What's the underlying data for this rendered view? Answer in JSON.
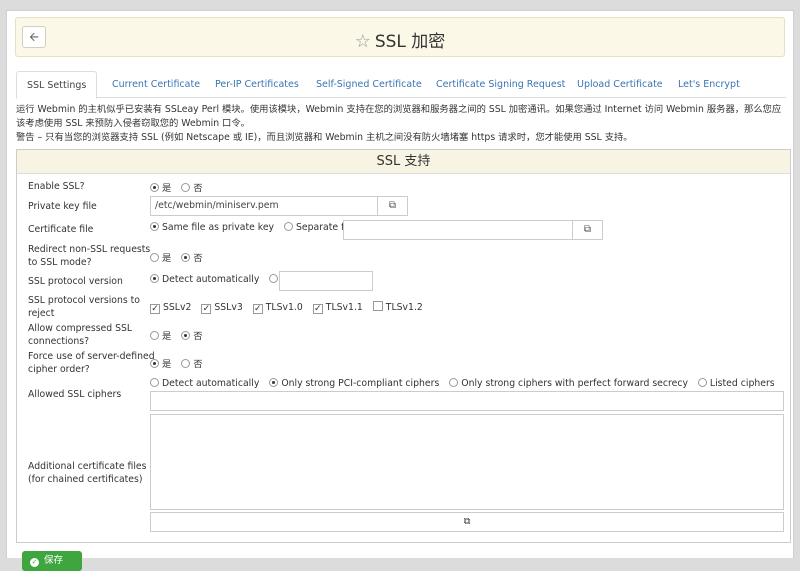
{
  "header": {
    "title": "SSL 加密",
    "back_icon": "back-arrow-icon",
    "star_icon": "star-icon"
  },
  "tabs": [
    {
      "label": "SSL Settings"
    },
    {
      "label": "Current Certificate"
    },
    {
      "label": "Per-IP Certificates"
    },
    {
      "label": "Self-Signed Certificate"
    },
    {
      "label": "Certificate Signing Request"
    },
    {
      "label": "Upload Certificate"
    },
    {
      "label": "Let's Encrypt"
    }
  ],
  "description": {
    "line1": "运行 Webmin 的主机似乎已安装有 SSLeay Perl 模块。使用该模块，Webmin 支持在您的浏览器和服务器之间的 SSL 加密通讯。如果您通过 Internet 访问 Webmin 服务器，那么您应",
    "line2": "该考虑使用 SSL 来预防入侵者窃取您的 Webmin 口令。",
    "warning": "警告 – 只有当您的浏览器支持 SSL (例如 Netscape 或 IE)，而且浏览器和 Webmin 主机之间没有防火墙堵塞 https 请求时，您才能使用 SSL 支持。"
  },
  "section": {
    "title": "SSL 支持",
    "enable_ssl": {
      "label": "Enable SSL?",
      "yes": "是",
      "no": "否"
    },
    "private_key": {
      "label": "Private key file",
      "value": "/etc/webmin/miniserv.pem"
    },
    "certificate": {
      "label": "Certificate file",
      "same": "Same file as private key",
      "separate": "Separate file"
    },
    "redirect": {
      "label": "Redirect non-SSL requests to SSL mode?",
      "yes": "是",
      "no": "否"
    },
    "protocol_version": {
      "label": "SSL protocol version",
      "auto": "Detect automatically"
    },
    "reject_versions": {
      "label": "SSL protocol versions to reject",
      "options": [
        {
          "label": "SSLv2",
          "checked": true
        },
        {
          "label": "SSLv3",
          "checked": true
        },
        {
          "label": "TLSv1.0",
          "checked": true
        },
        {
          "label": "TLSv1.1",
          "checked": true
        },
        {
          "label": "TLSv1.2",
          "checked": false
        }
      ]
    },
    "compressed": {
      "label": "Allow compressed SSL connections?",
      "yes": "是",
      "no": "否"
    },
    "force_cipher": {
      "label": "Force use of server-defined cipher order?",
      "yes": "是",
      "no": "否"
    },
    "ciphers": {
      "label": "Allowed SSL ciphers",
      "auto": "Detect automatically",
      "pci": "Only strong PCI-compliant ciphers",
      "pfs": "Only strong ciphers with perfect forward secrecy",
      "listed": "Listed ciphers"
    },
    "extra_certs": {
      "label1": "Additional certificate files",
      "label2": "(for chained certificates)"
    }
  },
  "save_button": {
    "label": "保存"
  }
}
